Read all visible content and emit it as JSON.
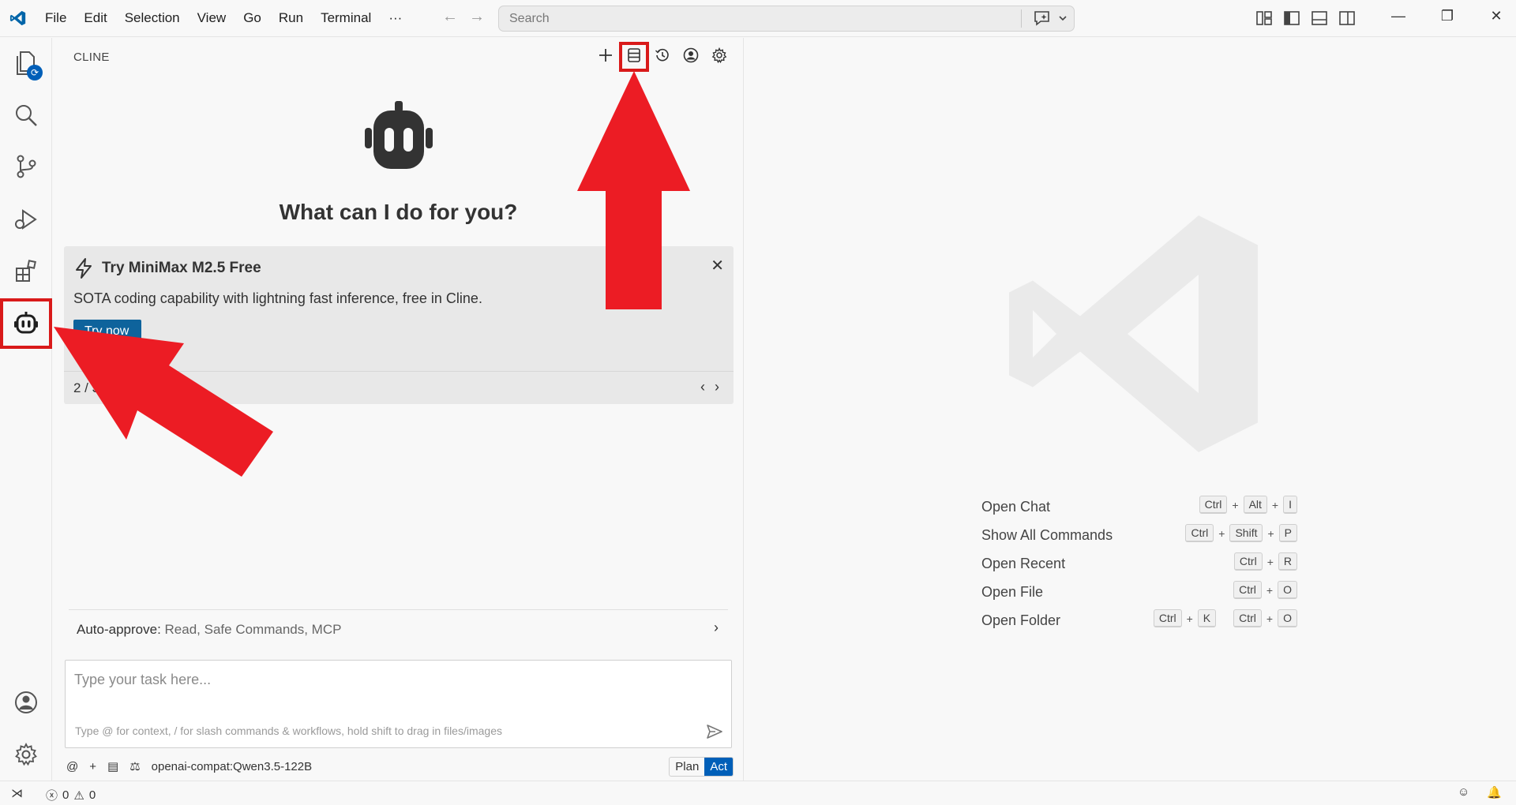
{
  "titlebar": {
    "menu": [
      "File",
      "Edit",
      "Selection",
      "View",
      "Go",
      "Run",
      "Terminal",
      "···"
    ],
    "search_placeholder": "Search"
  },
  "activity": {
    "items": [
      "explorer-icon",
      "search-icon",
      "source-control-icon",
      "run-debug-icon",
      "extensions-icon",
      "cline-icon"
    ],
    "bottom": [
      "account-icon",
      "manage-gear-icon"
    ]
  },
  "panel": {
    "title": "CLINE",
    "actions": [
      "plus-icon",
      "history-list-icon",
      "history-clock-icon",
      "account-icon",
      "settings-icon"
    ],
    "welcome": "What can I do for you?",
    "promo": {
      "title": "Try MiniMax M2.5 Free",
      "description": "SOTA coding capability with lightning fast inference, free in Cline.",
      "button": "Try now",
      "page": "2 / 3"
    },
    "auto_approve": {
      "label": "Auto-approve:",
      "value": "Read, Safe Commands, MCP"
    },
    "task": {
      "placeholder": "Type your task here...",
      "hint": "Type @ for context, / for slash commands & workflows, hold shift to drag in files/images"
    },
    "model": "openai-compat:Qwen3.5-122B",
    "mode_plan": "Plan",
    "mode_act": "Act"
  },
  "editor": {
    "shortcuts": [
      {
        "name": "Open Chat",
        "keys": [
          [
            "Ctrl",
            "Alt",
            "I"
          ]
        ]
      },
      {
        "name": "Show All Commands",
        "keys": [
          [
            "Ctrl",
            "Shift",
            "P"
          ]
        ]
      },
      {
        "name": "Open Recent",
        "keys": [
          [
            "Ctrl",
            "R"
          ]
        ]
      },
      {
        "name": "Open File",
        "keys": [
          [
            "Ctrl",
            "O"
          ]
        ]
      },
      {
        "name": "Open Folder",
        "keys": [
          [
            "Ctrl",
            "K"
          ],
          [
            "Ctrl",
            "O"
          ]
        ]
      }
    ]
  },
  "status": {
    "errors": "0",
    "warnings": "0"
  },
  "colors": {
    "accent": "#005fb8",
    "annotation_red": "#d91a1a"
  }
}
